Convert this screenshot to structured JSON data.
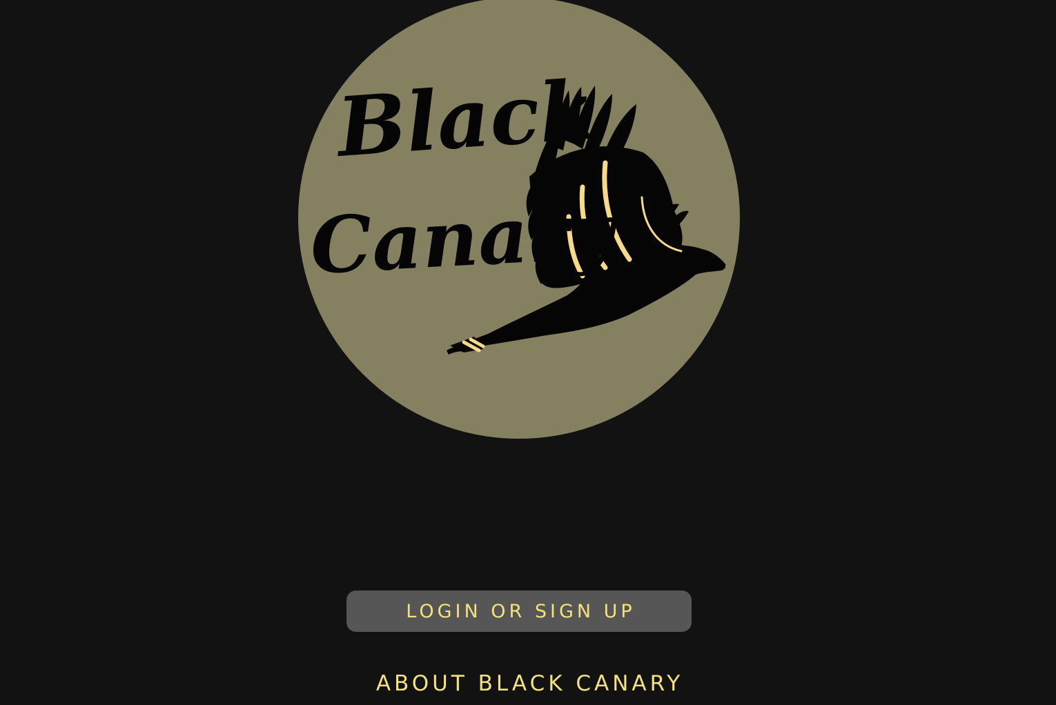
{
  "logo": {
    "line1": "Black",
    "line2": "Canary",
    "circle_color": "#858160",
    "ink_color": "#050505",
    "stripe_color": "#f7d98a",
    "icon": "canary-bird-icon"
  },
  "actions": {
    "login_label": "LOGIN OR SIGN UP",
    "about_label": "ABOUT BLACK CANARY"
  },
  "colors": {
    "background": "#121212",
    "button_bg": "#565656",
    "accent_text": "#f6e27a"
  }
}
